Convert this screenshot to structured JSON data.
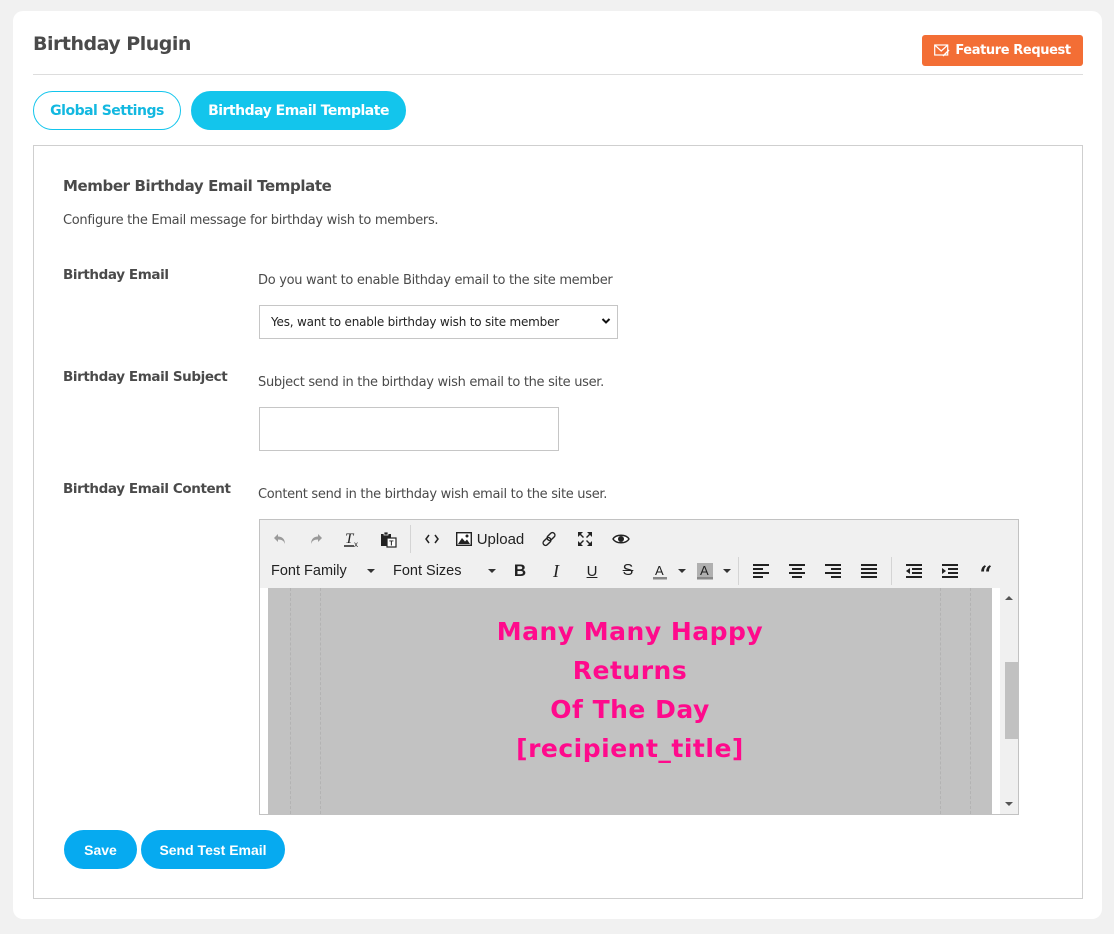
{
  "header": {
    "title": "Birthday Plugin",
    "feature_request_label": "Feature Request"
  },
  "tabs": [
    {
      "label": "Global Settings",
      "active": false
    },
    {
      "label": "Birthday Email Template",
      "active": true
    }
  ],
  "section": {
    "title": "Member Birthday Email Template",
    "description": "Configure the Email message for birthday wish to members."
  },
  "fields": {
    "birthday_email": {
      "label": "Birthday Email",
      "help": "Do you want to enable Bithday email to the site member",
      "selected": "Yes, want to enable birthday wish to site member"
    },
    "subject": {
      "label": "Birthday Email Subject",
      "help": "Subject send in the birthday wish email to the site user.",
      "value": ""
    },
    "content": {
      "label": "Birthday Email Content",
      "help": "Content send in the birthday wish email to the site user."
    }
  },
  "editor": {
    "toolbar": {
      "upload_label": "Upload",
      "font_family_label": "Font Family",
      "font_sizes_label": "Font Sizes"
    },
    "content_lines": [
      "Many Many Happy",
      "Returns",
      "Of The Day",
      "[recipient_title]"
    ],
    "text_color": "#ff0a8c",
    "background_color": "#c2c2c2"
  },
  "actions": {
    "save_label": "Save",
    "send_test_label": "Send Test Email"
  },
  "colors": {
    "accent": "#13c5ec",
    "feature_request": "#f36e35",
    "primary_button": "#06aaf0"
  }
}
